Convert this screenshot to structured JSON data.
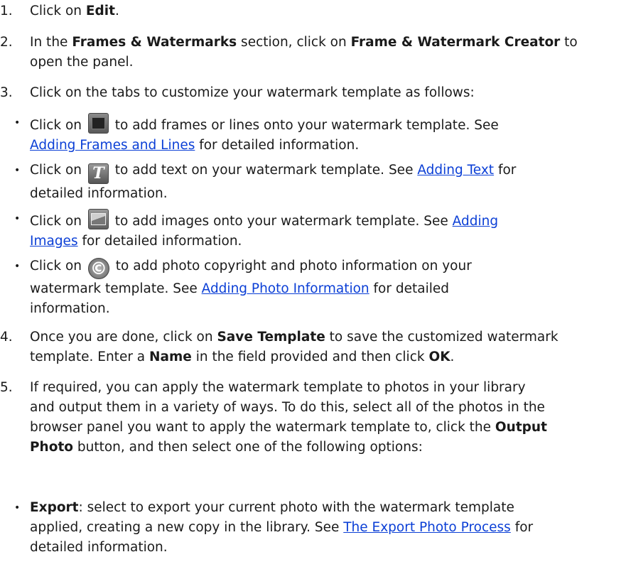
{
  "steps": [
    {
      "number": "1.",
      "pre": "Click on ",
      "bold": "Edit",
      "post": "."
    },
    {
      "number": "2.",
      "pre": "In the ",
      "bold1": "Frames & Watermarks",
      "mid": " section, click on ",
      "bold2": "Frame & Watermark Creator",
      "post1": " to",
      "line2": "open the panel."
    },
    {
      "number": "3.",
      "text": "Click on the tabs to customize your watermark template as follows:"
    },
    {
      "number": "4.",
      "pre": "Once you are done, click on ",
      "bold1": "Save Template",
      "post1": " to save the customized watermark",
      "line2_pre": "template. Enter a ",
      "bold2": "Name",
      "line2_mid": " in the field provided and then click ",
      "bold3": "OK",
      "line2_post": "."
    },
    {
      "number": "5.",
      "line1": "If required, you can apply the watermark template to photos in your library",
      "line2": "and output them in a variety of ways. To do this, select all of the photos in the",
      "line3": "browser panel you want to apply the watermark template to, click the ",
      "bold1": "Output",
      "line4_bold": "Photo",
      "line4_post": " button, and then select one of the following options:"
    }
  ],
  "bullets": [
    {
      "bullet": "•",
      "pre": "Click on ",
      "icon": "frame-icon",
      "post": " to add frames or lines onto your watermark template. See",
      "link": "Adding Frames and Lines",
      "after": " for detailed information."
    },
    {
      "bullet": "•",
      "pre": "Click on ",
      "icon": "text-icon",
      "post": " to add text on your watermark template. See ",
      "link": "Adding Text",
      "after": " for",
      "line2": "detailed information."
    },
    {
      "bullet": "•",
      "pre": "Click on ",
      "icon": "image-icon",
      "post": " to add images onto your watermark template. See ",
      "link": "Adding",
      "link2": "Images",
      "after": " for detailed information."
    },
    {
      "bullet": "•",
      "pre": "Click on ",
      "icon": "copyright-icon",
      "post": " to add photo copyright and photo information on your",
      "line2_pre": "watermark template. See ",
      "link": "Adding Photo Information",
      "line2_post": " for detailed",
      "line3": "information."
    }
  ],
  "export": {
    "bullet": "•",
    "bold": "Export",
    "line1": ": select to export your current photo with the watermark template",
    "line2_pre": "applied, creating a new copy in the library. See ",
    "link": "The Export Photo Process",
    "line2_post": " for",
    "line3": "detailed information."
  },
  "icons": {
    "copyright_glyph": "©",
    "text_glyph": "T"
  }
}
